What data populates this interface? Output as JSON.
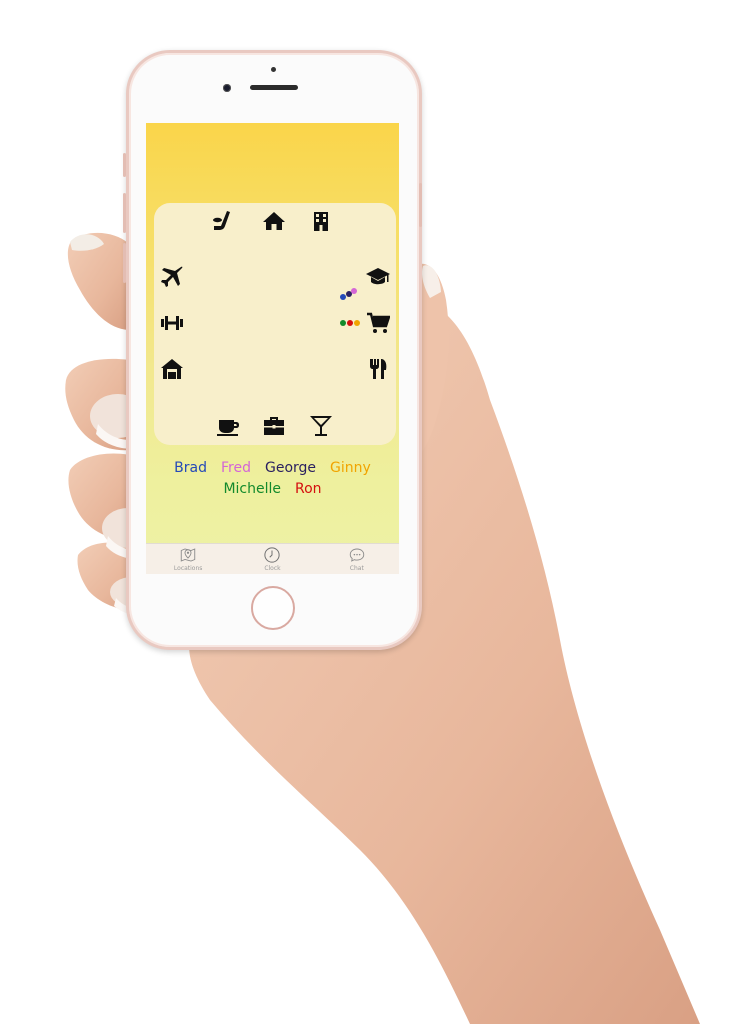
{
  "tabs": [
    {
      "label": "Locations",
      "icon": "map-pin-icon"
    },
    {
      "label": "Clock",
      "icon": "clock-icon"
    },
    {
      "label": "Chat",
      "icon": "chat-bubble-icon"
    }
  ],
  "people": [
    {
      "name": "Brad",
      "color": "#2449b8"
    },
    {
      "name": "Fred",
      "color": "#d466d6"
    },
    {
      "name": "George",
      "color": "#2b2160"
    },
    {
      "name": "Ginny",
      "color": "#f1a400"
    },
    {
      "name": "Michelle",
      "color": "#148a2c"
    },
    {
      "name": "Ron",
      "color": "#d40f0f"
    }
  ],
  "clock_icons": [
    "hockey-icon",
    "home-icon",
    "office-building-icon",
    "graduation-cap-icon",
    "shopping-cart-icon",
    "restaurant-icon",
    "cocktail-icon",
    "briefcase-icon",
    "coffee-cup-icon",
    "house-icon",
    "gym-dumbbell-icon",
    "airplane-icon"
  ],
  "colors": {
    "screen_top": "#fad54a",
    "screen_bottom": "#edf2a6",
    "clock_face": "#f8efcb",
    "phone_body": "#fbfbfb",
    "phone_rim": "#e9c9c1",
    "tabbar": "#f6efe7"
  }
}
